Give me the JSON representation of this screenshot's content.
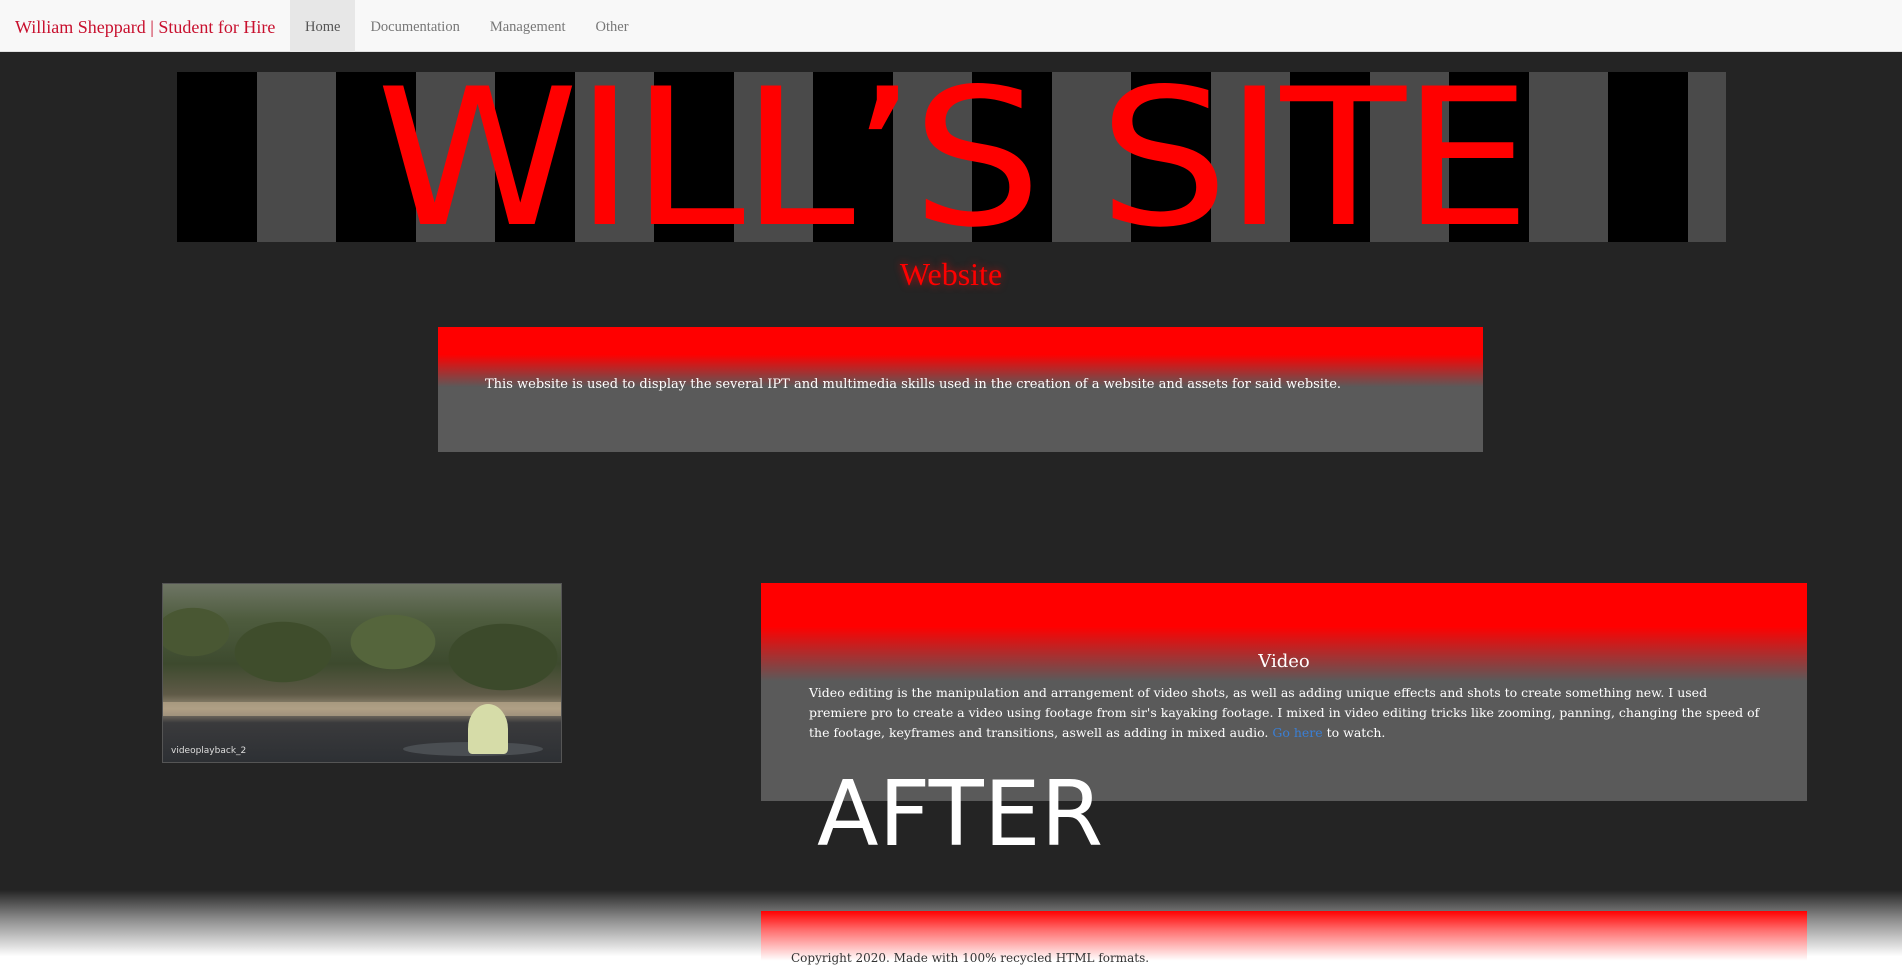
{
  "navbar": {
    "brand": "William Sheppard | Student for Hire",
    "items": [
      {
        "label": "Home",
        "active": true
      },
      {
        "label": "Documentation",
        "active": false
      },
      {
        "label": "Management",
        "active": false
      },
      {
        "label": "Other",
        "active": false
      }
    ]
  },
  "banner": {
    "text": "WILL’S SITE"
  },
  "subtitle": "Website",
  "intro": {
    "text": "This website is used to display the several IPT and multimedia skills used in the creation of a website and assets for said website."
  },
  "video_thumb": {
    "caption": "videoplayback_2"
  },
  "video_section": {
    "heading": "Video",
    "body": "Video editing is the manipulation and arrangement of video shots, as well as adding unique effects and shots to create something new. I used premiere pro to create a video using footage from sir's kayaking footage. I mixed in video editing tricks like zooming, panning, changing the speed of the footage, keyframes and transitions, aswell as adding in mixed audio.",
    "link_label": "Go here",
    "after_link": " to watch."
  },
  "after_label": "AFTER",
  "footer": {
    "text": "Copyright 2020. Made with 100% recycled HTML formats."
  },
  "colors": {
    "accent": "#ff0000",
    "brand": "#c8102e",
    "background": "#242424",
    "panel": "#5a5a5a",
    "link": "#3a7fd5"
  }
}
